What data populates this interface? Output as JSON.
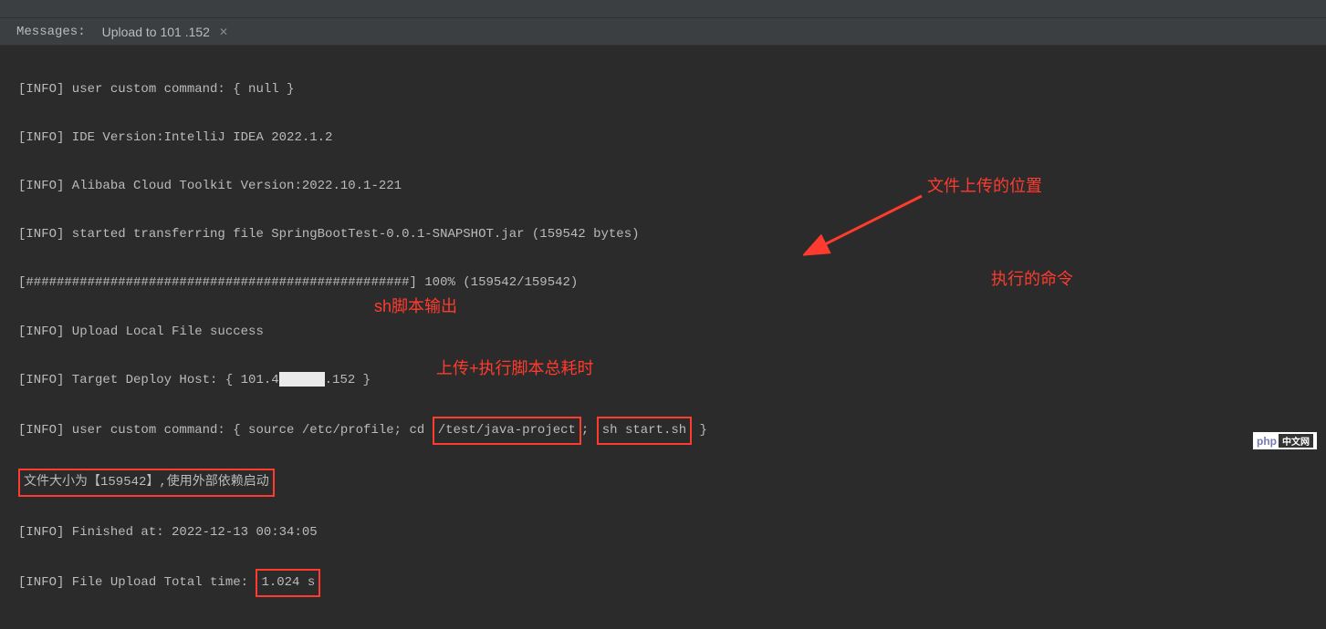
{
  "header": {
    "messages_label": "Messages:",
    "tab_title": "Upload to 101         .152"
  },
  "log": {
    "l1": "[INFO] user custom command: { null }",
    "l2": "[INFO] IDE Version:IntelliJ IDEA 2022.1.2",
    "l3": "[INFO] Alibaba Cloud Toolkit Version:2022.10.1-221",
    "l4": "[INFO] started transferring file SpringBootTest-0.0.1-SNAPSHOT.jar (159542 bytes)",
    "l5": "[##################################################] 100% (159542/159542)",
    "l6": "[INFO] Upload Local File success",
    "l7_a": "[INFO] Target Deploy Host: { 101.4",
    "l7_b": ".152 }",
    "l8_a": "[INFO] user custom command: { source /etc/profile; cd ",
    "l8_path": "/test/java-project",
    "l8_b": "; ",
    "l8_cmd": "sh start.sh",
    "l8_c": " }",
    "l9": "文件大小为【159542】,使用外部依赖启动",
    "l10": "[INFO] Finished at: 2022-12-13 00:34:05",
    "l11_a": "[INFO] File Upload Total time: ",
    "l11_time": "1.024 s"
  },
  "annotations": {
    "upload_location": "文件上传的位置",
    "exec_command": "执行的命令",
    "sh_output": "sh脚本输出",
    "total_time": "上传+执行脚本总耗时"
  },
  "watermark": {
    "php": "php",
    "cn": "中文网"
  }
}
